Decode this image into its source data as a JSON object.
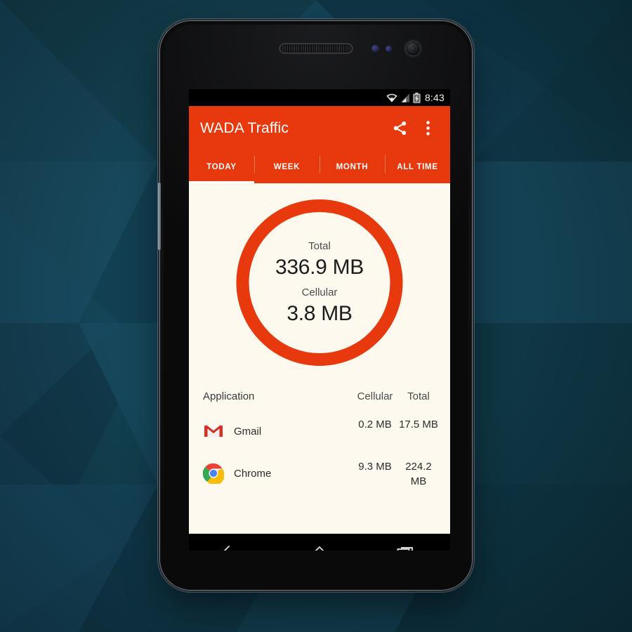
{
  "poster": {
    "background_color": "#12404f",
    "accent_color": "#e8380d",
    "content_background": "#fdf9ee"
  },
  "status_bar": {
    "wifi_icon": "wifi-icon",
    "signal_icon": "cellular-signal-icon",
    "battery_icon": "battery-charging-icon",
    "time": "8:43"
  },
  "app_bar": {
    "title": "WADA Traffic",
    "share_icon": "share-icon",
    "overflow_icon": "overflow-menu-icon"
  },
  "tabs": [
    {
      "label": "TODAY",
      "active": true
    },
    {
      "label": "WEEK",
      "active": false
    },
    {
      "label": "MONTH",
      "active": false
    },
    {
      "label": "ALL TIME",
      "active": false
    }
  ],
  "summary": {
    "total_label": "Total",
    "total_value": "336.9 MB",
    "cellular_label": "Cellular",
    "cellular_value": "3.8 MB"
  },
  "table": {
    "headers": {
      "application": "Application",
      "cellular": "Cellular",
      "total": "Total"
    },
    "rows": [
      {
        "icon": "gmail-icon",
        "name": "Gmail",
        "cellular": "0.2 MB",
        "total": "17.5 MB"
      },
      {
        "icon": "chrome-icon",
        "name": "Chrome",
        "cellular": "9.3 MB",
        "total": "224.2 MB"
      }
    ]
  },
  "nav_bar": {
    "back_icon": "back-icon",
    "home_icon": "home-icon",
    "recents_icon": "recents-icon"
  }
}
